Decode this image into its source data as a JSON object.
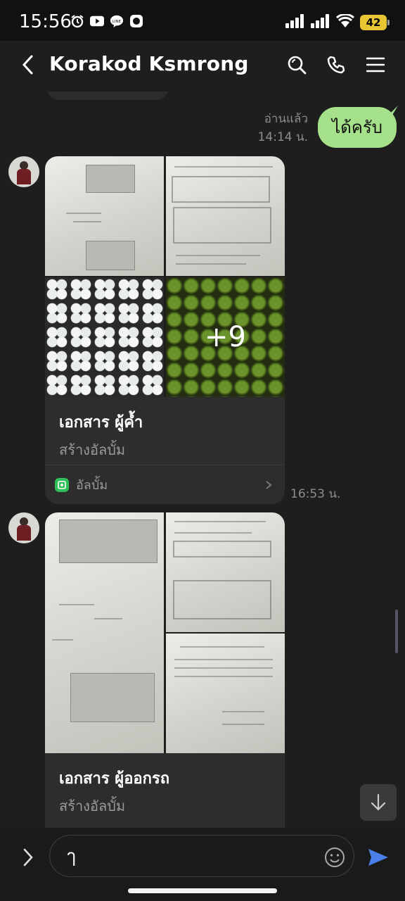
{
  "status_bar": {
    "time": "15:56",
    "battery": "42",
    "icons": [
      "alarm-icon",
      "youtube-icon",
      "line-icon",
      "app-icon",
      "signal-icon",
      "signal-icon",
      "wifi-icon",
      "battery-icon"
    ]
  },
  "header": {
    "title": "Korakod Ksmrong",
    "icons": [
      "back-icon",
      "search-icon",
      "phone-icon",
      "menu-icon"
    ]
  },
  "messages": {
    "sent": {
      "read_status": "อ่านแล้ว",
      "time": "14:14 น.",
      "text": "ได้ครับ"
    },
    "album1": {
      "title": "เอกสาร ผู้ค้ำ",
      "subtitle": "สร้างอัลบั้ม",
      "more_count": "+9",
      "footer_label": "อัลบั้ม",
      "time": "16:53 น."
    },
    "album2": {
      "title": "เอกสาร ผู้ออกรถ",
      "subtitle": "สร้างอัลบั้ม"
    }
  },
  "input": {
    "value": "ๅ",
    "icons": [
      "expand-icon",
      "emoji-icon",
      "send-icon"
    ]
  },
  "colors": {
    "sent_bubble": "#a5e08a",
    "background": "#1e1e1e",
    "send_accent": "#4a7fe8",
    "battery": "#e8c633"
  }
}
